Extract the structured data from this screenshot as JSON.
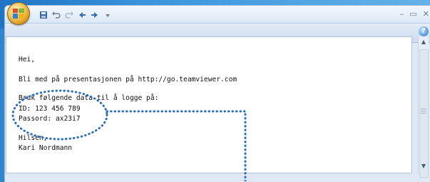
{
  "email": {
    "lines": [
      "Hei,",
      "Bli med på presentasjonen på http://go.teamviewer.com",
      "Bruk følgende data til å logge på:",
      "ID: 123 456 789",
      "Passord: ax23i7",
      "Hilsen,",
      "Kari Nordmann"
    ]
  },
  "window": {
    "controls": [
      "–",
      "▭",
      "✕"
    ],
    "help_label": "?"
  },
  "colors": {
    "highlight": "#2a6fbf",
    "titlebar": "#dce8f6"
  },
  "icons": {
    "office": "office-button-icon",
    "save": "save-icon",
    "undo": "undo-icon",
    "redo": "redo-icon",
    "prev": "previous-icon",
    "next": "next-icon"
  }
}
